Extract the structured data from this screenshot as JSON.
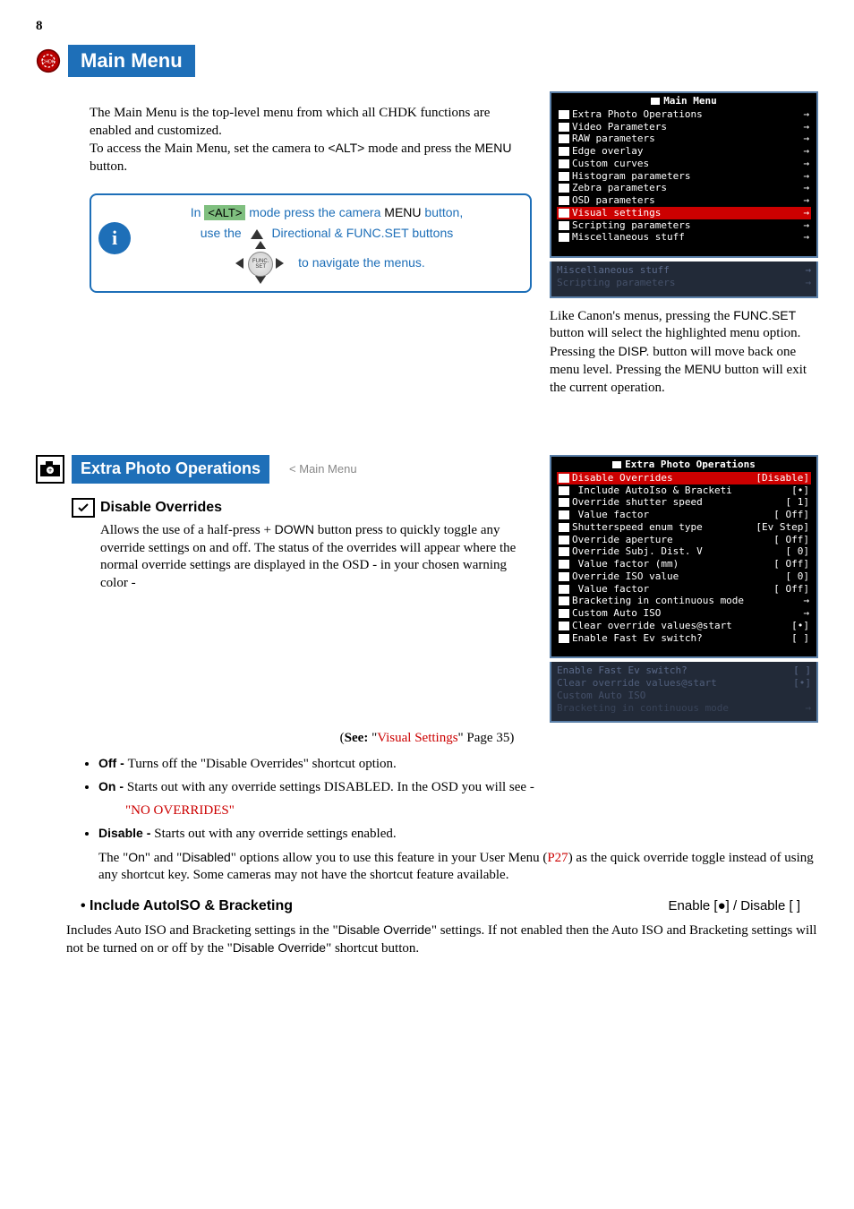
{
  "page_number": "8",
  "main_menu": {
    "heading": "Main Menu",
    "para": "The Main Menu is the top-level menu from which all CHDK functions are enabled and customized.",
    "para2_pre": "To access the Main Menu, set the camera to ",
    "alt_label": "<ALT>",
    "para2_post": " mode and press the ",
    "menu_word": "MENU",
    "para2_end": " button."
  },
  "screenshot_main": {
    "title": "Main Menu",
    "items": [
      "Extra Photo Operations",
      "Video Parameters",
      "RAW parameters",
      "Edge overlay",
      "Custom curves",
      "Histogram parameters",
      "Zebra parameters",
      "OSD parameters",
      "Visual settings",
      "Scripting parameters",
      "Miscellaneous stuff"
    ],
    "footer1": "Miscellaneous stuff",
    "footer2": "Scripting parameters",
    "selected_index": 8
  },
  "right_para": {
    "pre": "Like Canon's menus, pressing the ",
    "funcset": "FUNC.SET",
    "mid1": " button will select the highlighted menu option. Pressing the ",
    "disp": "DISP.",
    "mid2": " button will move back one menu level. Pressing the ",
    "menu": "MENU",
    "end": " button will exit the current operation."
  },
  "info_box": {
    "line1_pre": "In ",
    "alt": "<ALT>",
    "line1_mid": " mode press the camera ",
    "menu": "MENU",
    "line1_end": " button,",
    "line2_pre": "use the ",
    "line2_end": "Directional & FUNC.SET buttons",
    "line3": "to navigate the menus.",
    "func_label": "FUNC.\nSET"
  },
  "extra": {
    "heading": "Extra Photo Operations",
    "breadcrumb": "< Main Menu",
    "disable_heading": "Disable Overrides",
    "disable_para_pre": "Allows the use of a half-press + ",
    "down": "DOWN",
    "disable_para_post": " button press to quickly toggle any override settings on and off. The status of the overrides will appear where the normal override settings are displayed in the OSD - in your chosen warning color -",
    "see_label": "(See: \"",
    "see_link": "Visual Settings",
    "see_end": "\" Page 35)",
    "off_bold": "Off - ",
    "off_text": "Turns off the \"Disable Overrides\" shortcut option.",
    "on_bold": "On - ",
    "on_text": "Starts out with any override settings DISABLED. In the OSD you will see -",
    "no_overrides": "\"NO OVERRIDES\"",
    "disable_bold": "Disable - ",
    "disable_text": "Starts out with any override settings enabled.",
    "footer_pre": "The \"",
    "on_word": "On",
    "footer_mid1": "\" and \"",
    "disabled_word": "Disabled",
    "footer_mid2": "\" options allow you to use this feature in your User Menu (",
    "p27": "P27",
    "footer_end": ") as the quick override toggle instead of using any shortcut key. Some cameras may not have the shortcut feature available.",
    "include_heading": "•  Include AutoISO & Bracketing",
    "include_status": "Enable [●]  / Disable [  ]",
    "include_para_pre": "Includes Auto ISO and Bracketing settings in the \"",
    "disable_override1": "Disable Override",
    "include_para_mid": "\" settings. If not enabled then the Auto ISO and Bracketing settings will not be turned on or off by the \"",
    "include_para_end": "\" shortcut button."
  },
  "screenshot_extra": {
    "title": "Extra Photo Operations",
    "rows": [
      {
        "label": "Disable Overrides",
        "val": "[Disable]"
      },
      {
        "label": "  Include AutoIso & Bracketi",
        "val": "[•]"
      },
      {
        "label": "Override shutter speed",
        "val": "[     1]"
      },
      {
        "label": "  Value factor",
        "val": "[   Off]"
      },
      {
        "label": "Shutterspeed enum type",
        "val": "[Ev Step]"
      },
      {
        "label": "Override aperture",
        "val": "[   Off]"
      },
      {
        "label": "Override Subj. Dist. V",
        "val": "[     0]"
      },
      {
        "label": "  Value factor (mm)",
        "val": "[   Off]"
      },
      {
        "label": "Override ISO value",
        "val": "[     0]"
      },
      {
        "label": "  Value factor",
        "val": "[   Off]"
      },
      {
        "label": "Bracketing in continuous mode",
        "val": "→"
      },
      {
        "label": "Custom Auto ISO",
        "val": "→"
      },
      {
        "label": "Clear override values@start",
        "val": "[•]"
      },
      {
        "label": "Enable Fast Ev switch?",
        "val": "[ ]"
      }
    ],
    "footer": [
      {
        "label": "Enable Fast Ev switch?",
        "val": "[ ]"
      },
      {
        "label": "Clear override values@start",
        "val": "[•]"
      },
      {
        "label": "Custom Auto ISO",
        "val": ""
      },
      {
        "label": "Bracketing in continuous mode",
        "val": "→"
      }
    ]
  }
}
